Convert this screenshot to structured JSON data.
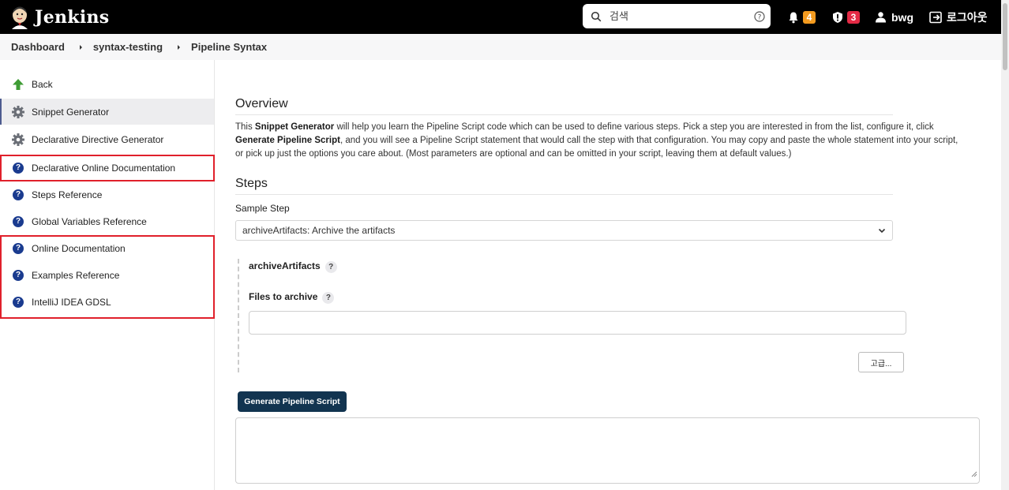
{
  "header": {
    "logo_text": "Jenkins",
    "search_placeholder": "검색",
    "notifications_count": "4",
    "security_count": "3",
    "user_name": "bwg",
    "logout_label": "로그아웃",
    "colors": {
      "bar": "#000000",
      "notif_badge": "#f49b1f",
      "security_badge": "#e32a45"
    }
  },
  "breadcrumb": [
    "Dashboard",
    "syntax-testing",
    "Pipeline Syntax"
  ],
  "sidebar": {
    "items": [
      {
        "label": "Back",
        "icon": "up-arrow-icon"
      },
      {
        "label": "Snippet Generator",
        "icon": "gear-icon",
        "active": true
      },
      {
        "label": "Declarative Directive Generator",
        "icon": "gear-icon"
      },
      {
        "label": "Declarative Online Documentation",
        "icon": "help-circle-icon"
      },
      {
        "label": "Steps Reference",
        "icon": "help-circle-icon"
      },
      {
        "label": "Global Variables Reference",
        "icon": "help-circle-icon"
      },
      {
        "label": "Online Documentation",
        "icon": "help-circle-icon"
      },
      {
        "label": "Examples Reference",
        "icon": "help-circle-icon"
      },
      {
        "label": "IntelliJ IDEA GDSL",
        "icon": "help-circle-icon"
      }
    ],
    "highlight_color": "#e0202b"
  },
  "main": {
    "overview_title": "Overview",
    "overview_text": {
      "p1": "This ",
      "b1": "Snippet Generator",
      "p2": " will help you learn the Pipeline Script code which can be used to define various steps. Pick a step you are interested in from the list, configure it, click ",
      "b2": "Generate Pipeline Script",
      "p3": ", and you will see a Pipeline Script statement that would call the step with that configuration. You may copy and paste the whole statement into your script, or pick up just the options you care about. (Most parameters are optional and can be omitted in your script, leaving them at default values.)"
    },
    "steps_title": "Steps",
    "sample_step_label": "Sample Step",
    "sample_step_value": "archiveArtifacts: Archive the artifacts",
    "step_name": "archiveArtifacts",
    "files_label": "Files to archive",
    "files_value": "",
    "advanced_label": "고급...",
    "generate_label": "Generate Pipeline Script",
    "output_value": ""
  }
}
